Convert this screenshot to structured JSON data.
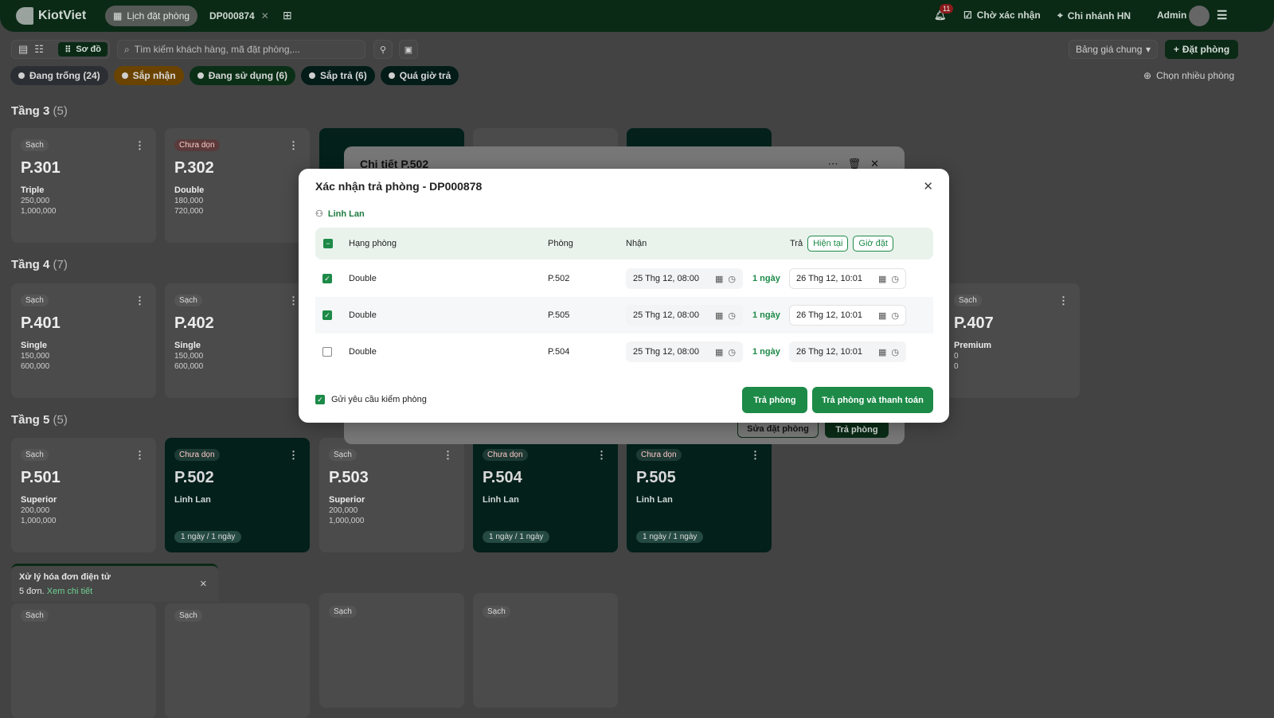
{
  "header": {
    "brand": "KiotViet",
    "tab_active": "Lịch đặt phòng",
    "tab_booking": "DP000874",
    "notif_count": "11",
    "pending": "Chờ xác nhận",
    "branch": "Chi nhánh HN",
    "user": "Admin"
  },
  "toolbar": {
    "view_map": "Sơ đồ",
    "search_placeholder": "Tìm kiếm khách hàng, mã đặt phòng,...",
    "price_list": "Bảng giá chung",
    "book_button": "Đặt phòng",
    "select_multiple": "Chọn nhiều phòng"
  },
  "filters": [
    {
      "label": "Đang trống (24)",
      "color": "#4b5563"
    },
    {
      "label": "Sắp nhận",
      "color": "#e08a00"
    },
    {
      "label": "Đang sử dụng (6)",
      "color": "#1d7a3d"
    },
    {
      "label": "Sắp trả (6)",
      "color": "#0b4a3e"
    },
    {
      "label": "Quá giờ trả",
      "color": "#0b4a3e"
    }
  ],
  "floors": [
    {
      "name": "Tầng 3",
      "count": "(5)"
    },
    {
      "name": "Tầng 4",
      "count": "(7)"
    },
    {
      "name": "Tầng 5",
      "count": "(5)"
    }
  ],
  "rooms": {
    "p301": {
      "status": "Sạch",
      "name": "P.301",
      "type": "Triple",
      "p1": "250,000",
      "p2": "1,000,000"
    },
    "p302": {
      "status": "Chưa dọn",
      "name": "P.302",
      "type": "Double",
      "p1": "180,000",
      "p2": "720,000"
    },
    "p401": {
      "status": "Sạch",
      "name": "P.401",
      "type": "Single",
      "p1": "150,000",
      "p2": "600,000"
    },
    "p402": {
      "status": "Sạch",
      "name": "P.402",
      "type": "Single",
      "p1": "150,000",
      "p2": "600,000"
    },
    "p407": {
      "status": "Sạch",
      "name": "P.407",
      "type": "Premium",
      "p1": "0",
      "p2": "0"
    },
    "p501": {
      "status": "Sạch",
      "name": "P.501",
      "type": "Superior",
      "p1": "200,000",
      "p2": "1,000,000"
    },
    "p502": {
      "status": "Chưa dọn",
      "name": "P.502",
      "guest": "Linh Lan",
      "duration": "1 ngày / 1 ngày"
    },
    "p503": {
      "status": "Sạch",
      "name": "P.503",
      "type": "Superior",
      "p1": "200,000",
      "p2": "1,000,000"
    },
    "p504": {
      "status": "Chưa dọn",
      "name": "P.504",
      "guest": "Linh Lan",
      "duration": "1 ngày / 1 ngày"
    },
    "p505": {
      "status": "Chưa dọn",
      "name": "P.505",
      "guest": "Linh Lan",
      "duration": "1 ngày / 1 ngày"
    },
    "clean": "Sạch"
  },
  "toast": {
    "title": "Xử lý hóa đơn điện tử",
    "text": "5 đơn.",
    "link": "Xem chi tiết"
  },
  "detail_panel": {
    "title": "Chi tiết P.502",
    "edit": "Sửa đặt phòng",
    "checkout": "Trả phòng"
  },
  "modal": {
    "title": "Xác nhận trả phòng - DP000878",
    "customer": "Linh Lan",
    "columns": {
      "type": "Hạng phòng",
      "room": "Phòng",
      "checkin": "Nhận",
      "checkout": "Trả",
      "now": "Hiện tại",
      "booked": "Giờ đặt"
    },
    "rows": [
      {
        "checked": true,
        "type": "Double",
        "room": "P.502",
        "checkin": "25 Thg 12, 08:00",
        "days": "1 ngày",
        "checkout": "26 Thg 12, 10:01"
      },
      {
        "checked": true,
        "type": "Double",
        "room": "P.505",
        "checkin": "25 Thg 12, 08:00",
        "days": "1 ngày",
        "checkout": "26 Thg 12, 10:01"
      },
      {
        "checked": false,
        "type": "Double",
        "room": "P.504",
        "checkin": "25 Thg 12, 08:00",
        "days": "1 ngày",
        "checkout": "26 Thg 12, 10:01"
      }
    ],
    "send_inspection": "Gửi yêu cầu kiểm phòng",
    "btn_checkout": "Trả phòng",
    "btn_checkout_pay": "Trả phòng và thanh toán"
  }
}
